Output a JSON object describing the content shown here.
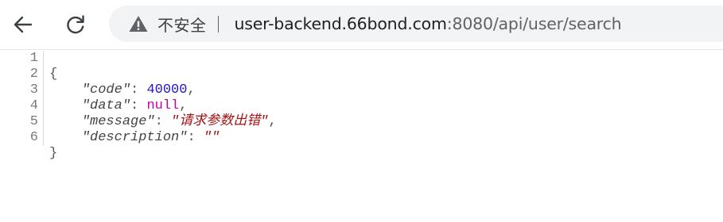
{
  "toolbar": {
    "back_icon": "arrow-left-icon",
    "reload_icon": "reload-icon"
  },
  "omnibox": {
    "security_icon": "warning-triangle-icon",
    "security_label": "不安全",
    "url_host": "user-backend.66bond.com",
    "url_rest": ":8080/api/user/search"
  },
  "viewer": {
    "line_numbers": [
      "1",
      "2",
      "3",
      "4",
      "5",
      "6"
    ],
    "open_brace": "{",
    "close_brace": "}",
    "fields": [
      {
        "key": "\"code\"",
        "colon": ": ",
        "value": "40000",
        "comma": ","
      },
      {
        "key": "\"data\"",
        "colon": ": ",
        "value": "null",
        "comma": ","
      },
      {
        "key": "\"message\"",
        "colon": ": ",
        "value": "\"请求参数出错\"",
        "comma": ","
      },
      {
        "key": "\"description\"",
        "colon": ": ",
        "value": "\"\"",
        "comma": ""
      }
    ],
    "colors": {
      "number": "#2417c9",
      "null": "#c000a9",
      "string": "#a31515"
    }
  }
}
